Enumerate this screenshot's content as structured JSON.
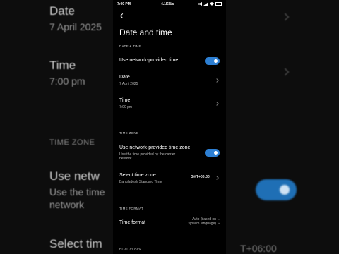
{
  "background": {
    "date_label": "Date",
    "date_value": "7 April 2025",
    "time_label": "Time",
    "time_value": "7:00 pm",
    "time_zone_header": "TIME ZONE",
    "use_network_partial": "Use netw",
    "use_network_sub_line1": "Use the time",
    "use_network_sub_line2": "network",
    "select_partial": "Select tim",
    "gmt_partial": "T+06:00"
  },
  "status_bar": {
    "time": "7:00 PM",
    "dots": "...",
    "speed": "4.1KB/s"
  },
  "header": {
    "title": "Date and time"
  },
  "sections": {
    "date_time_header": "DATE & TIME",
    "time_zone_header": "TIME ZONE",
    "time_format_header": "TIME FORMAT",
    "dual_clock_header": "DUAL CLOCK"
  },
  "rows": {
    "use_network_time": {
      "label": "Use network-provided time",
      "enabled": true
    },
    "date": {
      "label": "Date",
      "value": "7 April 2025"
    },
    "time": {
      "label": "Time",
      "value": "7:00 pm"
    },
    "use_network_time_zone": {
      "label": "Use network-provided time zone",
      "sub_line1": "Use the time provided by the carrier",
      "sub_line2": "network",
      "enabled": true
    },
    "select_time_zone": {
      "label": "Select time zone",
      "value": "Bangladesh Standard Time",
      "offset": "GMT+06:00"
    },
    "time_format": {
      "label": "Time format",
      "value_line1": "Auto (based on",
      "value_line2": "system language)"
    }
  },
  "colors": {
    "accent": "#2d7fd3",
    "background": "#000000"
  }
}
